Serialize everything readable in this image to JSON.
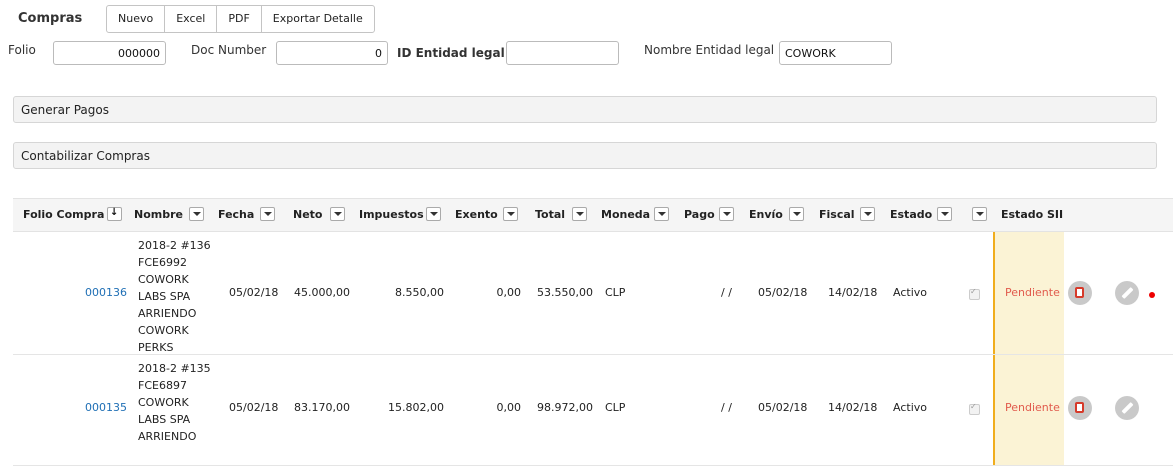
{
  "header": {
    "title": "Compras",
    "buttons": [
      "Nuevo",
      "Excel",
      "PDF",
      "Exportar Detalle"
    ]
  },
  "filters": {
    "folio_label": "Folio",
    "folio_value": "000000",
    "doc_number_label": "Doc Number",
    "doc_number_value": "0",
    "id_entidad_label": "ID Entidad legal",
    "id_entidad_value": "",
    "nombre_entidad_label": "Nombre Entidad legal",
    "nombre_entidad_value": "COWORK"
  },
  "panels": {
    "generar_pagos": "Generar Pagos",
    "contabilizar": "Contabilizar Compras"
  },
  "table": {
    "headers": {
      "folio": "Folio Compra",
      "nombre": "Nombre",
      "fecha": "Fecha",
      "neto": "Neto",
      "impuestos": "Impuestos",
      "exento": "Exento",
      "total": "Total",
      "moneda": "Moneda",
      "pago": "Pago",
      "envio": "Envío",
      "fiscal": "Fiscal",
      "estado": "Estado",
      "estado_sii": "Estado SII"
    },
    "rows": [
      {
        "folio": "000136",
        "nombre": "2018-2 #136 FCE6992 COWORK LABS SPA ARRIENDO COWORK PERKS",
        "fecha": "05/02/18",
        "neto": "45.000,00",
        "impuestos": "8.550,00",
        "exento": "0,00",
        "total": "53.550,00",
        "moneda": "CLP",
        "pago": "/ /",
        "envio": "05/02/18",
        "fiscal": "14/02/18",
        "estado": "Activo",
        "estado_sii": "Pendiente"
      },
      {
        "folio": "000135",
        "nombre": "2018-2 #135 FCE6897 COWORK LABS SPA ARRIENDO",
        "fecha": "05/02/18",
        "neto": "83.170,00",
        "impuestos": "15.802,00",
        "exento": "0,00",
        "total": "98.972,00",
        "moneda": "CLP",
        "pago": "/ /",
        "envio": "05/02/18",
        "fiscal": "14/02/18",
        "estado": "Activo",
        "estado_sii": "Pendiente"
      }
    ]
  }
}
